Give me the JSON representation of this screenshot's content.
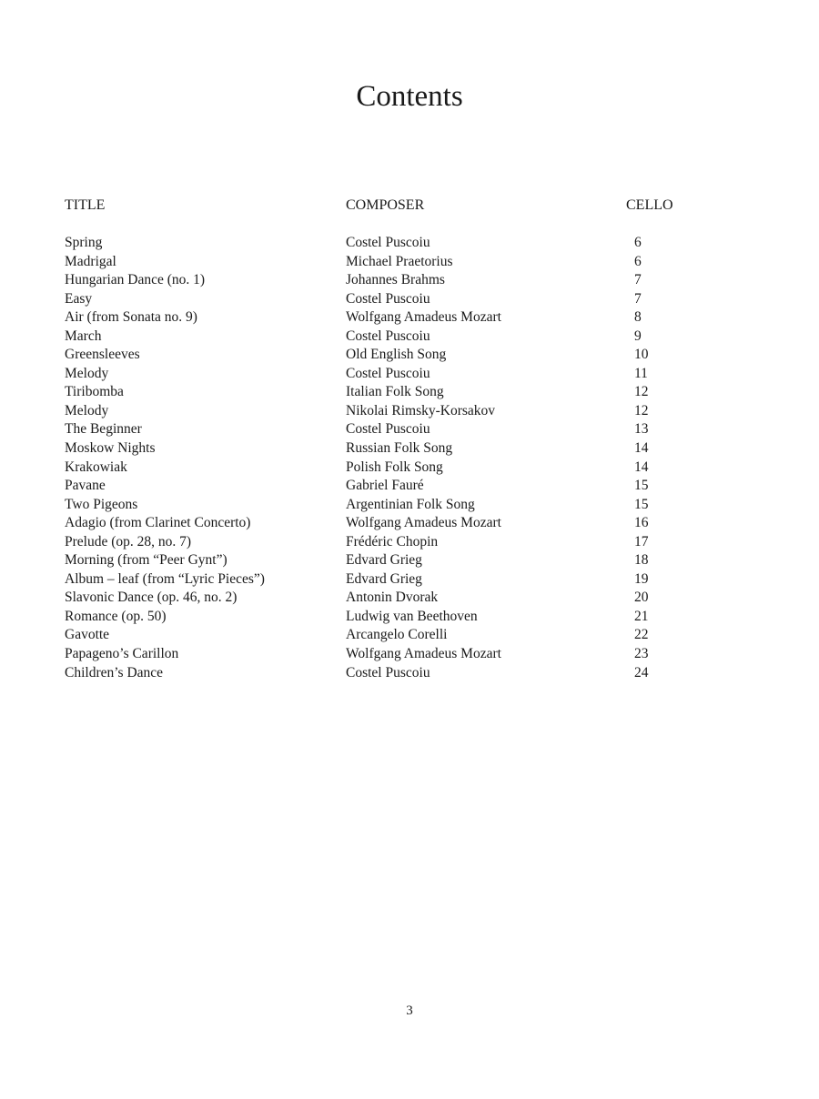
{
  "heading": "Contents",
  "columns": {
    "title": "TITLE",
    "composer": "COMPOSER",
    "page": "CELLO"
  },
  "entries": [
    {
      "title": "Spring",
      "composer": "Costel Puscoiu",
      "page": "6"
    },
    {
      "title": "Madrigal",
      "composer": "Michael Praetorius",
      "page": "6"
    },
    {
      "title": "Hungarian Dance (no. 1)",
      "composer": "Johannes Brahms",
      "page": "7"
    },
    {
      "title": "Easy",
      "composer": "Costel Puscoiu",
      "page": "7"
    },
    {
      "title": "Air (from Sonata no. 9)",
      "composer": "Wolfgang Amadeus Mozart",
      "page": "8"
    },
    {
      "title": "March",
      "composer": "Costel Puscoiu",
      "page": "9"
    },
    {
      "title": "Greensleeves",
      "composer": "Old English Song",
      "page": "10"
    },
    {
      "title": "Melody",
      "composer": "Costel Puscoiu",
      "page": "11"
    },
    {
      "title": "Tiribomba",
      "composer": "Italian Folk Song",
      "page": "12"
    },
    {
      "title": "Melody",
      "composer": "Nikolai Rimsky-Korsakov",
      "page": "12"
    },
    {
      "title": "The Beginner",
      "composer": "Costel Puscoiu",
      "page": "13"
    },
    {
      "title": "Moskow Nights",
      "composer": "Russian Folk Song",
      "page": "14"
    },
    {
      "title": "Krakowiak",
      "composer": "Polish Folk Song",
      "page": "14"
    },
    {
      "title": "Pavane",
      "composer": "Gabriel Fauré",
      "page": "15"
    },
    {
      "title": "Two Pigeons",
      "composer": "Argentinian Folk Song",
      "page": "15"
    },
    {
      "title": "Adagio (from Clarinet Concerto)",
      "composer": "Wolfgang Amadeus Mozart",
      "page": "16"
    },
    {
      "title": "Prelude (op. 28, no. 7)",
      "composer": "Frédéric Chopin",
      "page": "17"
    },
    {
      "title": "Morning (from “Peer Gynt”)",
      "composer": "Edvard Grieg",
      "page": "18"
    },
    {
      "title": "Album – leaf (from “Lyric Pieces”)",
      "composer": "Edvard Grieg",
      "page": "19"
    },
    {
      "title": "Slavonic Dance (op. 46, no. 2)",
      "composer": "Antonin Dvorak",
      "page": "20"
    },
    {
      "title": "Romance (op. 50)",
      "composer": "Ludwig van Beethoven",
      "page": "21"
    },
    {
      "title": "Gavotte",
      "composer": "Arcangelo Corelli",
      "page": "22"
    },
    {
      "title": "Papageno’s Carillon",
      "composer": "Wolfgang Amadeus Mozart",
      "page": "23"
    },
    {
      "title": "Children’s Dance",
      "composer": "Costel Puscoiu",
      "page": "24"
    }
  ],
  "page_number": "3"
}
